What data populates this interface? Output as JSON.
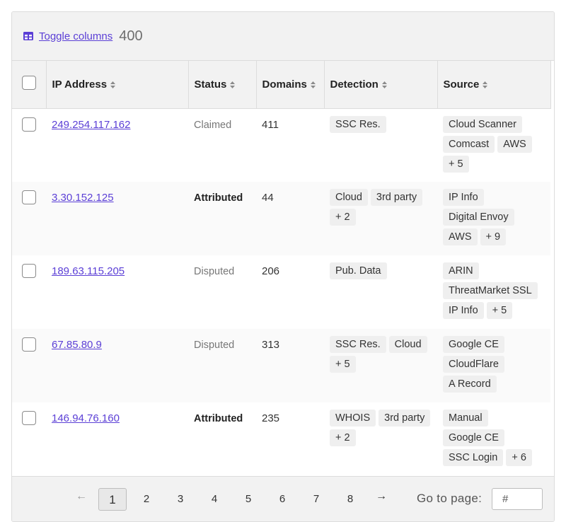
{
  "toolbar": {
    "toggle_label": "Toggle columns",
    "count": "400"
  },
  "columns": [
    "IP Address",
    "Status",
    "Domains",
    "Detection",
    "Source"
  ],
  "rows": [
    {
      "ip": "249.254.117.162",
      "status": "Claimed",
      "status_bold": false,
      "domains": "411",
      "detection": [
        "SSC Res."
      ],
      "source": [
        "Cloud Scanner",
        "Comcast",
        "AWS",
        "+ 5"
      ]
    },
    {
      "ip": "3.30.152.125",
      "status": "Attributed",
      "status_bold": true,
      "domains": "44",
      "detection": [
        "Cloud",
        "3rd party",
        "+ 2"
      ],
      "source": [
        "IP Info",
        "Digital Envoy",
        "AWS",
        "+ 9"
      ]
    },
    {
      "ip": "189.63.115.205",
      "status": "Disputed",
      "status_bold": false,
      "domains": "206",
      "detection": [
        "Pub. Data"
      ],
      "source": [
        "ARIN",
        "ThreatMarket SSL",
        "IP Info",
        "+ 5"
      ]
    },
    {
      "ip": "67.85.80.9",
      "status": "Disputed",
      "status_bold": false,
      "domains": "313",
      "detection": [
        "SSC Res.",
        "Cloud",
        "+ 5"
      ],
      "source": [
        "Google CE",
        "CloudFlare",
        "A Record"
      ]
    },
    {
      "ip": "146.94.76.160",
      "status": "Attributed",
      "status_bold": true,
      "domains": "235",
      "detection": [
        "WHOIS",
        "3rd party",
        "+ 2"
      ],
      "source": [
        "Manual",
        "Google CE",
        "SSC Login",
        "+ 6"
      ]
    }
  ],
  "pagination": {
    "prev": "←",
    "next": "→",
    "pages": [
      "1",
      "2",
      "3",
      "4",
      "5",
      "6",
      "7",
      "8"
    ],
    "current": "1",
    "goto_label": "Go to page:",
    "goto_placeholder": "#"
  }
}
